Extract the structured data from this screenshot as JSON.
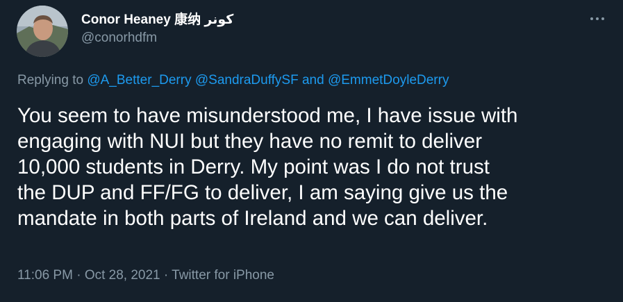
{
  "user": {
    "display_name": "Conor Heaney 康纳 كونر",
    "handle": "@conorhdfm"
  },
  "more_icon": "more-horizontal-icon",
  "replying": {
    "prefix": "Replying to",
    "mention_1": "@A_Better_Derry",
    "mention_2": "@SandraDuffySF",
    "conjunction": "and",
    "mention_3": "@EmmetDoyleDerry"
  },
  "tweet": {
    "lines": [
      "You seem to have misunderstood me, I have issue with",
      "engaging with NUI but they have no remit to deliver",
      "10,000 students in Derry. My point was I do not trust",
      "the DUP and FF/FG to deliver, I am saying give us the",
      "mandate in both parts of Ireland and we can deliver."
    ]
  },
  "meta": {
    "time": "11:06 PM",
    "separator_1": "·",
    "date": "Oct 28, 2021",
    "separator_2": "·",
    "source": "Twitter for iPhone"
  },
  "colors": {
    "background": "#15202b",
    "text": "#ffffff",
    "secondary": "#8899a6",
    "link": "#1d9bf0"
  }
}
